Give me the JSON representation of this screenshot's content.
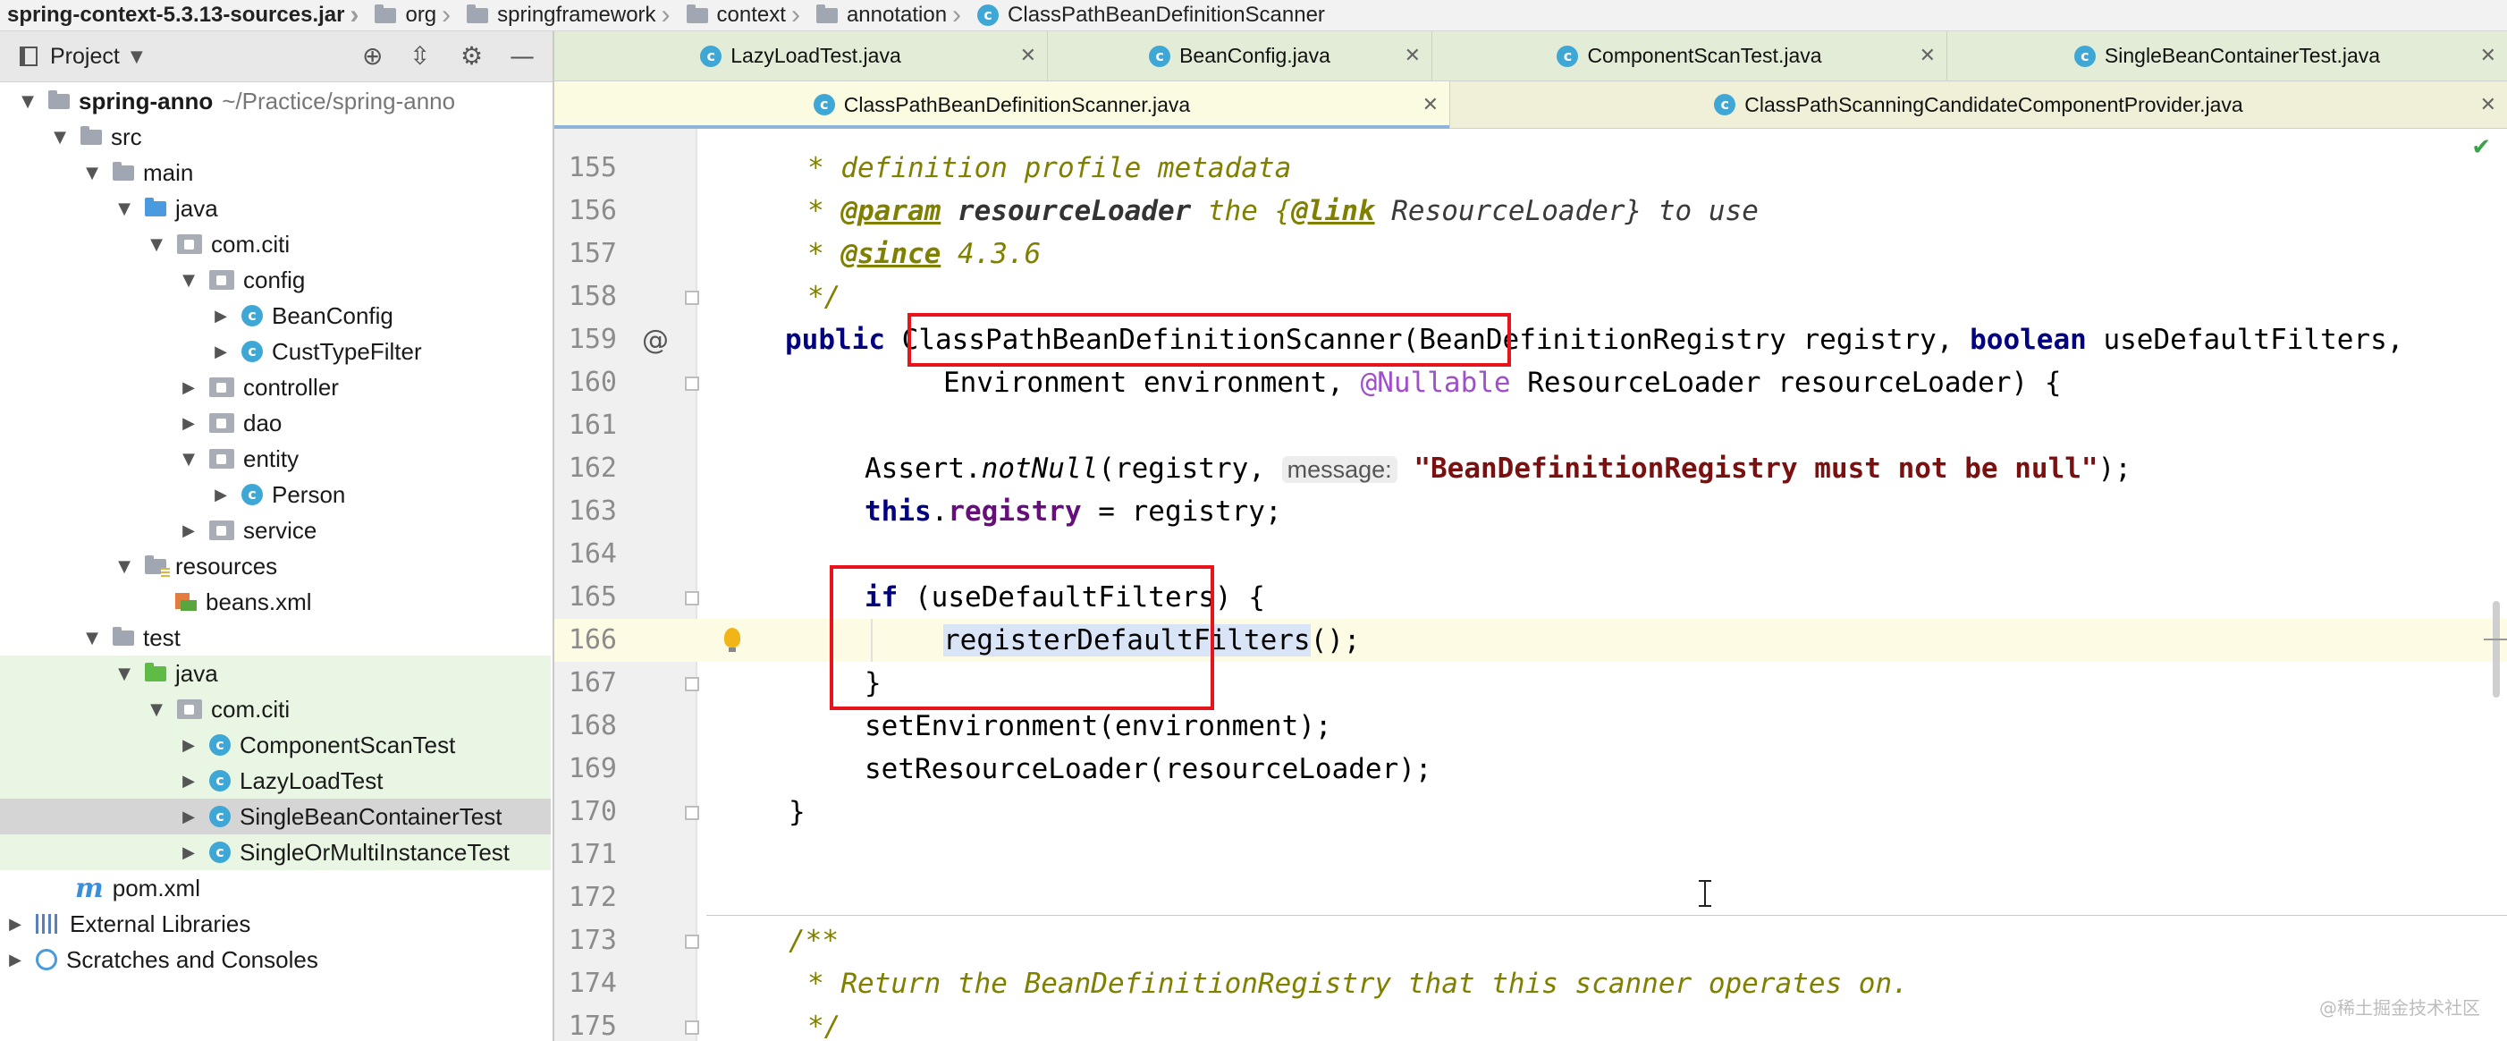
{
  "breadcrumb": {
    "jar": "spring-context-5.3.13-sources.jar",
    "items": [
      "org",
      "springframework",
      "context",
      "annotation"
    ],
    "current": "ClassPathBeanDefinitionScanner"
  },
  "project_panel": {
    "title": "Project",
    "tree": [
      {
        "label": "spring-anno",
        "hint": "~/Practice/spring-anno"
      },
      {
        "label": "src"
      },
      {
        "label": "main"
      },
      {
        "label": "java"
      },
      {
        "label": "com.citi"
      },
      {
        "label": "config"
      },
      {
        "label": "BeanConfig"
      },
      {
        "label": "CustTypeFilter"
      },
      {
        "label": "controller"
      },
      {
        "label": "dao"
      },
      {
        "label": "entity"
      },
      {
        "label": "Person"
      },
      {
        "label": "service"
      },
      {
        "label": "resources"
      },
      {
        "label": "beans.xml"
      },
      {
        "label": "test"
      },
      {
        "label": "java"
      },
      {
        "label": "com.citi"
      },
      {
        "label": "ComponentScanTest"
      },
      {
        "label": "LazyLoadTest"
      },
      {
        "label": "SingleBeanContainerTest"
      },
      {
        "label": "SingleOrMultiInstanceTest"
      },
      {
        "label": "pom.xml"
      },
      {
        "label": "External Libraries"
      },
      {
        "label": "Scratches and Consoles"
      }
    ]
  },
  "tabs_row1": [
    "LazyLoadTest.java",
    "BeanConfig.java",
    "ComponentScanTest.java",
    "SingleBeanContainerTest.java"
  ],
  "tabs_row2": [
    "ClassPathBeanDefinitionScanner.java",
    "ClassPathScanningCandidateComponentProvider.java"
  ],
  "editor": {
    "line_numbers": [
      "155",
      "156",
      "157",
      "158",
      "159",
      "160",
      "161",
      "162",
      "163",
      "164",
      "165",
      "166",
      "167",
      "168",
      "169",
      "170",
      "171",
      "172",
      "173",
      "174",
      "175"
    ],
    "lines": {
      "l155a": "* ",
      "l155b": "definition profile metadata",
      "l156a": "* ",
      "l156tag": "@param",
      "l156name": "resourceLoader",
      "l156b": " the {",
      "l156link": "@link",
      "l156c": " ResourceLoader} to use",
      "l157a": "* ",
      "l157tag": "@since",
      "l157b": " 4.3.6",
      "l158": "*/",
      "l159kw": "public",
      "l159name": "ClassPathBeanDefinitionScanner",
      "l159rest": "(BeanDefinitionRegistry registry, ",
      "l159kw2": "boolean",
      "l159end": " useDefaultFilters,",
      "l160a": "Environment environment, ",
      "l160ann": "@Nullable",
      "l160b": " ResourceLoader resourceLoader) {",
      "l162a": "Assert.",
      "l162m": "notNull",
      "l162b": "(registry, ",
      "l162hint": "message:",
      "l162str": "\"BeanDefinitionRegistry must not be null\"",
      "l162c": ");",
      "l163kw": "this",
      "l163dot": ".",
      "l163fld": "registry",
      "l163b": " = registry;",
      "l165kw": "if",
      "l165b": " (useDefaultFilters) {",
      "l166sel": "registerDefaultFilters",
      "l166b": "();",
      "l167": "}",
      "l168": "setEnvironment(environment);",
      "l169": "setResourceLoader(resourceLoader);",
      "l170": "}",
      "l173": "/**",
      "l174": "* Return the BeanDefinitionRegistry that this scanner operates on.",
      "l175": "*/"
    }
  },
  "watermark": "@稀土掘金技术社区"
}
